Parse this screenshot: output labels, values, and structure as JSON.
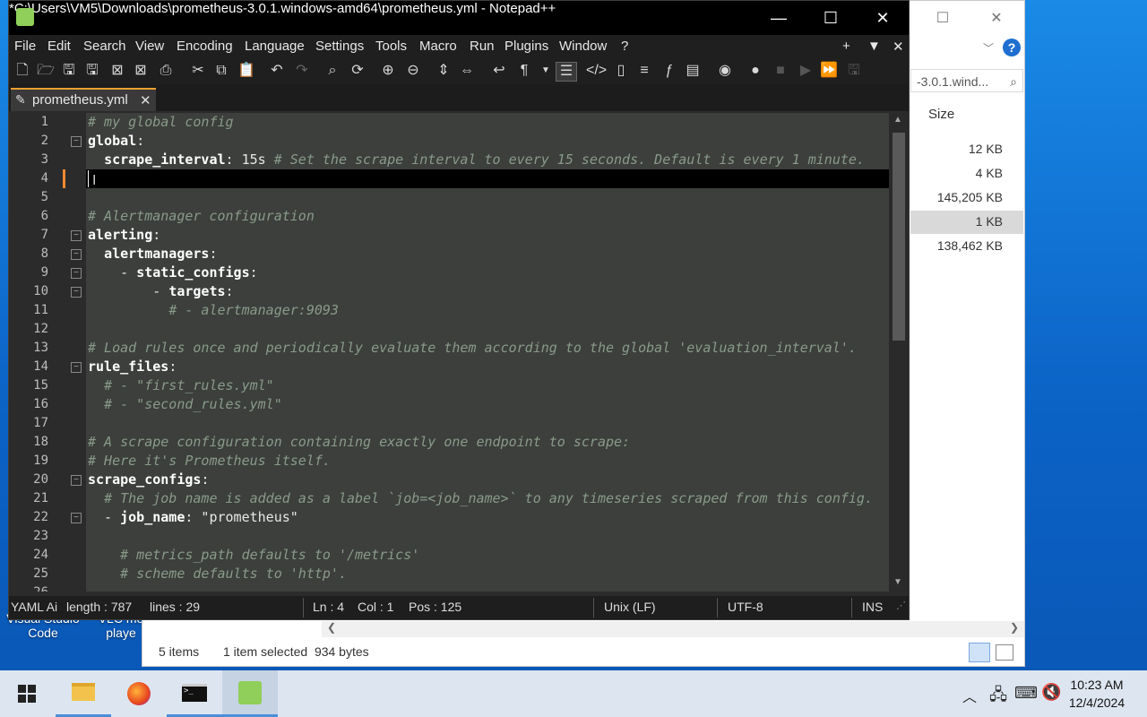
{
  "desktop": {
    "icon_labels": [
      {
        "line1": "Visual Studio",
        "line2": "Code"
      },
      {
        "line1": "VLC me",
        "line2": "playe"
      }
    ]
  },
  "explorer": {
    "address_text": "-3.0.1.wind...",
    "size_header": "Size",
    "sizes": [
      "12 KB",
      "4 KB",
      "145,205 KB",
      "1 KB",
      "138,462 KB"
    ],
    "status_items": "5 items",
    "status_selected": "1 item selected  934 bytes"
  },
  "npp": {
    "title": "*C:\\Users\\VM5\\Downloads\\prometheus-3.0.1.windows-amd64\\prometheus.yml - Notepad++",
    "menu": [
      "File",
      "Edit",
      "Search",
      "View",
      "Encoding",
      "Language",
      "Settings",
      "Tools",
      "Macro",
      "Run",
      "Plugins",
      "Window",
      "?"
    ],
    "tab_label": "prometheus.yml",
    "lines": [
      {
        "n": "1",
        "segs": [
          {
            "c": "cm",
            "t": "# my global config"
          }
        ]
      },
      {
        "n": "2",
        "segs": [
          {
            "c": "kw",
            "t": "global"
          },
          {
            "c": "str",
            "t": ":"
          }
        ]
      },
      {
        "n": "3",
        "segs": [
          {
            "c": "str",
            "t": "  "
          },
          {
            "c": "kw",
            "t": "scrape_interval"
          },
          {
            "c": "str",
            "t": ": 15s "
          },
          {
            "c": "cm",
            "t": "# Set the scrape interval to every 15 seconds. Default is every 1 minute."
          }
        ]
      },
      {
        "n": "4",
        "segs": [
          {
            "c": "str",
            "t": ""
          }
        ]
      },
      {
        "n": "5",
        "segs": [
          {
            "c": "str",
            "t": ""
          }
        ]
      },
      {
        "n": "6",
        "segs": [
          {
            "c": "cm",
            "t": "# Alertmanager configuration"
          }
        ]
      },
      {
        "n": "7",
        "segs": [
          {
            "c": "kw",
            "t": "alerting"
          },
          {
            "c": "str",
            "t": ":"
          }
        ]
      },
      {
        "n": "8",
        "segs": [
          {
            "c": "str",
            "t": "  "
          },
          {
            "c": "kw",
            "t": "alertmanagers"
          },
          {
            "c": "str",
            "t": ":"
          }
        ]
      },
      {
        "n": "9",
        "segs": [
          {
            "c": "str",
            "t": "    - "
          },
          {
            "c": "kw",
            "t": "static_configs"
          },
          {
            "c": "str",
            "t": ":"
          }
        ]
      },
      {
        "n": "10",
        "segs": [
          {
            "c": "str",
            "t": "        - "
          },
          {
            "c": "kw",
            "t": "targets"
          },
          {
            "c": "str",
            "t": ":"
          }
        ]
      },
      {
        "n": "11",
        "segs": [
          {
            "c": "str",
            "t": "          "
          },
          {
            "c": "cm",
            "t": "# - alertmanager:9093"
          }
        ]
      },
      {
        "n": "12",
        "segs": [
          {
            "c": "str",
            "t": ""
          }
        ]
      },
      {
        "n": "13",
        "segs": [
          {
            "c": "cm",
            "t": "# Load rules once and periodically evaluate them according to the global 'evaluation_interval'."
          }
        ]
      },
      {
        "n": "14",
        "segs": [
          {
            "c": "kw",
            "t": "rule_files"
          },
          {
            "c": "str",
            "t": ":"
          }
        ]
      },
      {
        "n": "15",
        "segs": [
          {
            "c": "str",
            "t": "  "
          },
          {
            "c": "cm",
            "t": "# - \"first_rules.yml\""
          }
        ]
      },
      {
        "n": "16",
        "segs": [
          {
            "c": "str",
            "t": "  "
          },
          {
            "c": "cm",
            "t": "# - \"second_rules.yml\""
          }
        ]
      },
      {
        "n": "17",
        "segs": [
          {
            "c": "str",
            "t": ""
          }
        ]
      },
      {
        "n": "18",
        "segs": [
          {
            "c": "cm",
            "t": "# A scrape configuration containing exactly one endpoint to scrape:"
          }
        ]
      },
      {
        "n": "19",
        "segs": [
          {
            "c": "cm",
            "t": "# Here it's Prometheus itself."
          }
        ]
      },
      {
        "n": "20",
        "segs": [
          {
            "c": "kw",
            "t": "scrape_configs"
          },
          {
            "c": "str",
            "t": ":"
          }
        ]
      },
      {
        "n": "21",
        "segs": [
          {
            "c": "str",
            "t": "  "
          },
          {
            "c": "cm",
            "t": "# The job name is added as a label `job=<job_name>` to any timeseries scraped from this config."
          }
        ]
      },
      {
        "n": "22",
        "segs": [
          {
            "c": "str",
            "t": "  - "
          },
          {
            "c": "kw",
            "t": "job_name"
          },
          {
            "c": "str",
            "t": ": \"prometheus\""
          }
        ]
      },
      {
        "n": "23",
        "segs": [
          {
            "c": "str",
            "t": ""
          }
        ]
      },
      {
        "n": "24",
        "segs": [
          {
            "c": "str",
            "t": "    "
          },
          {
            "c": "cm",
            "t": "# metrics_path defaults to '/metrics'"
          }
        ]
      },
      {
        "n": "25",
        "segs": [
          {
            "c": "str",
            "t": "    "
          },
          {
            "c": "cm",
            "t": "# scheme defaults to 'http'."
          }
        ]
      },
      {
        "n": "26",
        "segs": [
          {
            "c": "str",
            "t": ""
          }
        ]
      }
    ],
    "status": {
      "lang": "YAML Ai",
      "length": "length : 787",
      "lines": "lines : 29",
      "ln": "Ln : 4",
      "col": "Col : 1",
      "pos": "Pos : 125",
      "eol": "Unix (LF)",
      "enc": "UTF-8",
      "mode": "INS"
    }
  },
  "clock": {
    "time": "10:23 AM",
    "date": "12/4/2024"
  }
}
